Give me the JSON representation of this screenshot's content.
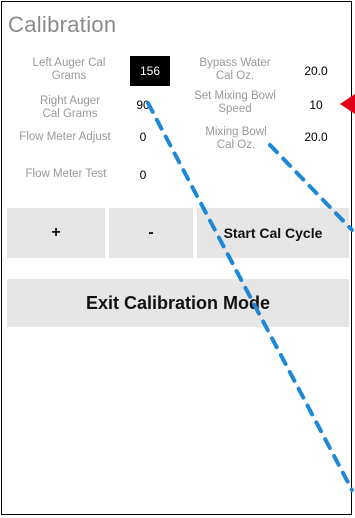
{
  "screen": {
    "title": "Calibration"
  },
  "fields": {
    "left_auger_cal_grams": {
      "label": "Left Auger Cal Grams",
      "value": "156",
      "colors": {
        "bg": "#000000",
        "fg": "#ffffff"
      }
    },
    "right_auger_cal_grams": {
      "label": "Right Auger Cal Grams",
      "value": "90"
    },
    "flow_meter_adjust": {
      "label": "Flow Meter Adjust",
      "value": "0"
    },
    "flow_meter_test": {
      "label": "Flow Meter Test",
      "value": "0"
    },
    "bypass_water_cal_oz": {
      "label": "Bypass Water Cal Oz.",
      "value": "20.0"
    },
    "set_mixing_bowl_speed": {
      "label": "Set Mixing Bowl Speed",
      "value": "10"
    },
    "mixing_bowl_cal_oz": {
      "label": "Mixing Bowl Cal Oz.",
      "value": "20.0"
    }
  },
  "buttons": {
    "plus": "+",
    "minus": "-",
    "start_cal_cycle": "Start Cal Cycle",
    "exit_calibration_mode": "Exit Calibration Mode"
  },
  "annotations": {
    "dashed_line_color": "#1e88d8",
    "arrow_color": "#e0001a"
  }
}
